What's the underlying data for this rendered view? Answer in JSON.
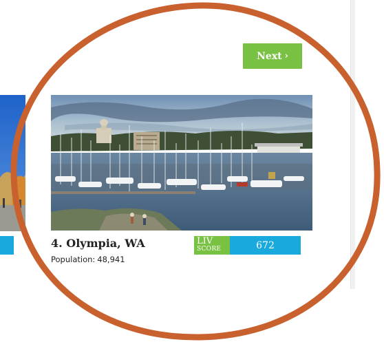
{
  "navigation": {
    "next_label": "Next",
    "next_chevron": "›"
  },
  "card": {
    "rank": "4.",
    "city": "Olympia, WA",
    "population_label": "Population:",
    "population_value": "48,941",
    "liv_label": "LIV",
    "score_label": "SCORE",
    "liv_score": "672"
  },
  "colors": {
    "accent_green": "#79c143",
    "accent_blue": "#1aa9dc",
    "highlight_circle": "#c8612e"
  }
}
